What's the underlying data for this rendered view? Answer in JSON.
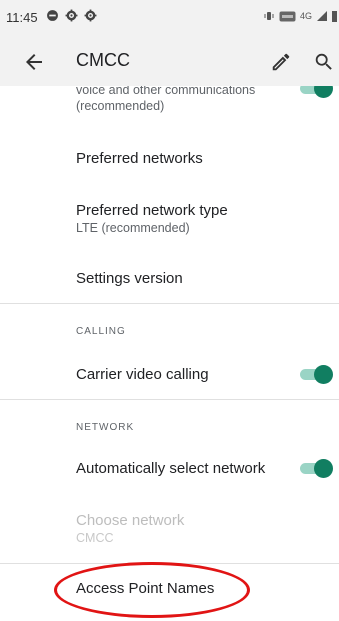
{
  "status_bar": {
    "time": "11:45",
    "network_label": "4G"
  },
  "toolbar": {
    "title": "CMCC"
  },
  "settings": {
    "top_item": {
      "subtitle_line1": "voice and other communications",
      "subtitle_line2": "(recommended)"
    },
    "preferred_networks": {
      "title": "Preferred networks"
    },
    "preferred_network_type": {
      "title": "Preferred network type",
      "subtitle": "LTE (recommended)"
    },
    "settings_version": {
      "title": "Settings version"
    },
    "calling_header": "CALLING",
    "carrier_video_calling": {
      "title": "Carrier video calling",
      "enabled": true
    },
    "network_header": "NETWORK",
    "auto_select_network": {
      "title": "Automatically select network",
      "enabled": true
    },
    "choose_network": {
      "title": "Choose network",
      "subtitle": "CMCC",
      "disabled": true
    },
    "access_point_names": {
      "title": "Access Point Names"
    }
  },
  "colors": {
    "toggle_thumb": "#117e61",
    "toggle_track": "#9ad4c5",
    "highlight_ring": "#e11414"
  }
}
